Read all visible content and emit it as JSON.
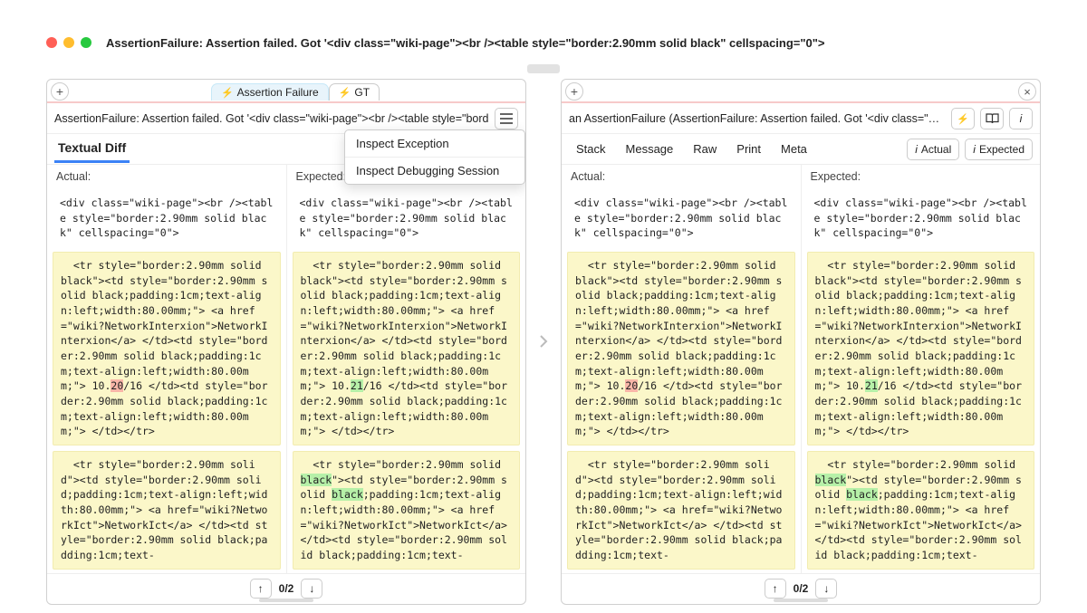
{
  "window": {
    "title": "AssertionFailure: Assertion failed. Got '<div class=\"wiki-page\"><br /><table style=\"border:2.90mm solid black\" cellspacing=\"0\">"
  },
  "tabs": {
    "assertion": "Assertion Failure",
    "gt": "GT"
  },
  "breadcrumb_left": "AssertionFailure: Assertion failed. Got '<div class=\"wiki-page\"><br /><table style=\"bord",
  "breadcrumb_right": "an AssertionFailure (AssertionFailure: Assertion failed. Got '<div class=\"wiki",
  "menu": {
    "item1": "Inspect Exception",
    "item2": "Inspect Debugging Session"
  },
  "buttons": {
    "actual": "Actual",
    "expected": "Expected"
  },
  "subnav_left": {
    "title": "Textual Diff"
  },
  "subnav_right": {
    "stack": "Stack",
    "message": "Message",
    "raw": "Raw",
    "print": "Print",
    "meta": "Meta"
  },
  "colheads": {
    "actual": "Actual:",
    "expected": "Expected:"
  },
  "blocks": {
    "b1": "<div class=\"wiki-page\"><br /><table style=\"border:2.90mm solid black\" cellspacing=\"0\">",
    "b2_pre": "  <tr style=\"border:2.90mm solid black\"><td style=\"border:2.90mm solid black;padding:1cm;text-align:left;width:80.00mm;\"> <a href=\"wiki?NetworkInterxion\">NetworkInterxion</a> </td><td style=\"border:2.90mm solid black;padding:1cm;text-align:left;width:80.00mm;\"> 10.",
    "b2_num_a": "20",
    "b2_num_e": "21",
    "b2_post": "/16 </td><td style=\"border:2.90mm solid black;padding:1cm;text-align:left;width:80.00mm;\"> </td></tr>",
    "b3_actual": "  <tr style=\"border:2.90mm solid\"><td style=\"border:2.90mm solid;padding:1cm;text-align:left;width:80.00mm;\"> <a href=\"wiki?NetworkIct\">NetworkIct</a> </td><td style=\"border:2.90mm solid black;padding:1cm;text-",
    "b3_exp_pre1": "  <tr style=\"border:2.90mm solid ",
    "b3_exp_black": "black",
    "b3_exp_mid1": "\"><td style=\"border:2.90mm solid ",
    "b3_exp_post": ";padding:1cm;text-align:left;width:80.00mm;\"> <a href=\"wiki?NetworkIct\">NetworkIct</a> </td><td style=\"border:2.90mm solid black;padding:1cm;text-"
  },
  "pager": {
    "text": "0/2"
  }
}
